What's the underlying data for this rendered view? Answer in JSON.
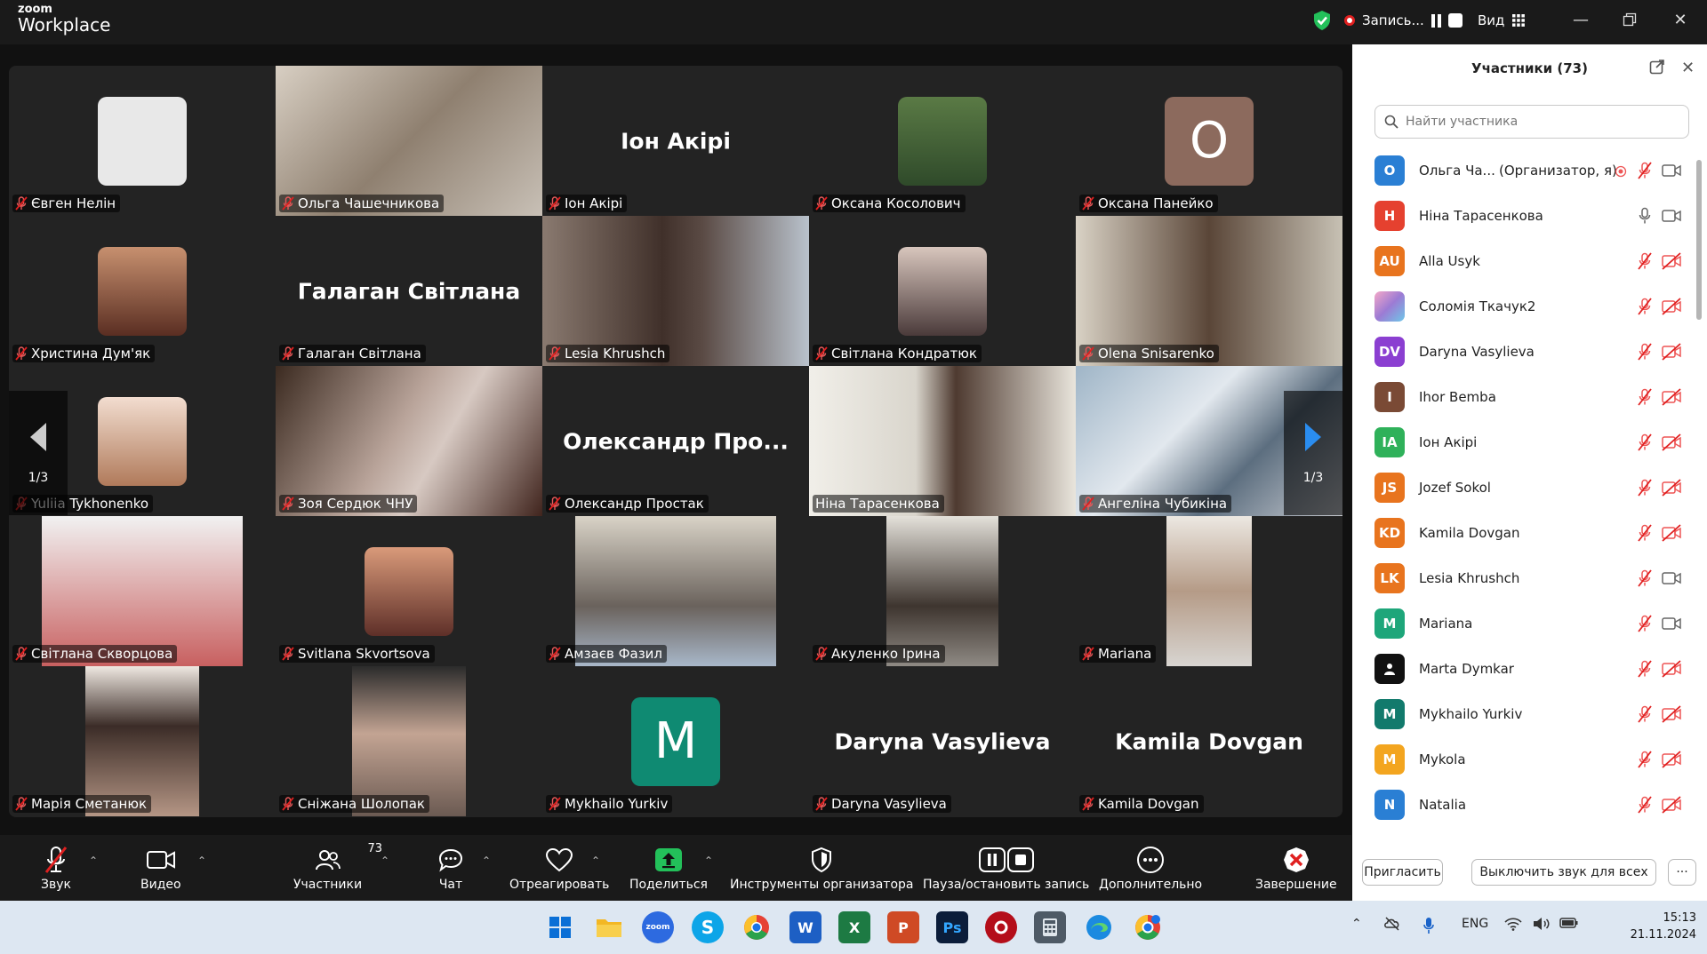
{
  "app": {
    "logo_top": "zoom",
    "logo_bottom": "Workplace"
  },
  "titlebar": {
    "recording_label": "Запись...",
    "view_label": "Вид"
  },
  "gallery": {
    "page_indicator_left": "1/3",
    "page_indicator_right": "1/3",
    "tiles": [
      {
        "name": "Євген Нелін",
        "kind": "photo"
      },
      {
        "name": "Ольга Чашечникова",
        "kind": "video"
      },
      {
        "name": "Іон Акірі",
        "kind": "text",
        "big": "Іон Акірі"
      },
      {
        "name": "Оксана Косолович",
        "kind": "photo"
      },
      {
        "name": "Оксана Панейко",
        "kind": "avatar",
        "letter": "O"
      },
      {
        "name": "Христина Дум'як",
        "kind": "photo"
      },
      {
        "name": "Галаган Світлана",
        "kind": "text",
        "big": "Галаган Світлана"
      },
      {
        "name": "Lesia Khrushch",
        "kind": "video"
      },
      {
        "name": "Світлана Кондратюк",
        "kind": "photo"
      },
      {
        "name": "Olena Snisarenko",
        "kind": "video"
      },
      {
        "name": "Yuliia Tykhonenko",
        "kind": "photo"
      },
      {
        "name": "Зоя Сердюк ЧНУ",
        "kind": "video"
      },
      {
        "name": "Олександр Простак",
        "kind": "text",
        "big": "Олександр  Про..."
      },
      {
        "name": "Ніна Тарасенкова",
        "kind": "video"
      },
      {
        "name": "Ангеліна Чубикіна",
        "kind": "video"
      },
      {
        "name": "Світлана Скворцова",
        "kind": "video"
      },
      {
        "name": "Svitlana Skvortsova",
        "kind": "photo"
      },
      {
        "name": "Амзаєв Фазил",
        "kind": "video"
      },
      {
        "name": "Акуленко Ірина",
        "kind": "video"
      },
      {
        "name": "Mariana",
        "kind": "video"
      },
      {
        "name": "Марія Сметанюк",
        "kind": "video"
      },
      {
        "name": "Сніжана Шолопак",
        "kind": "video"
      },
      {
        "name": "Mykhailo Yurkiv",
        "kind": "avatar",
        "letter": "M"
      },
      {
        "name": "Daryna Vasylieva",
        "kind": "text",
        "big": "Daryna Vasylieva"
      },
      {
        "name": "Kamila Dovgan",
        "kind": "text",
        "big": "Kamila Dovgan"
      }
    ]
  },
  "toolbar": {
    "audio": "Звук",
    "video": "Видео",
    "participants": "Участники",
    "participants_count": "73",
    "chat": "Чат",
    "react": "Отреагировать",
    "share": "Поделиться",
    "host_tools": "Инструменты организатора",
    "pause_record": "Пауза/остановить запись",
    "more": "Дополнительно",
    "end": "Завершение"
  },
  "panel": {
    "title": "Участники (73)",
    "search_placeholder": "Найти участника",
    "invite": "Пригласить",
    "mute_all": "Выключить звук для всех",
    "more": "···",
    "participants": [
      {
        "initials": "O",
        "name": "Ольга Ча...",
        "role": "(Организатор, я)",
        "color": "#2a7fd4",
        "mic": "off",
        "cam": "on"
      },
      {
        "initials": "H",
        "name": "Ніна Тарасенкова",
        "role": "",
        "color": "#e5412f",
        "mic": "on",
        "cam": "on"
      },
      {
        "initials": "AU",
        "name": "Alla Usyk",
        "role": "",
        "color": "#e8741e",
        "mic": "off",
        "cam": "off"
      },
      {
        "initials": "",
        "name": "Соломія Ткачук2",
        "role": "",
        "color": "#9c7bd4",
        "mic": "off",
        "cam": "off"
      },
      {
        "initials": "DV",
        "name": "Daryna Vasylieva",
        "role": "",
        "color": "#8b3fd1",
        "mic": "off",
        "cam": "off"
      },
      {
        "initials": "I",
        "name": "Ihor Bemba",
        "role": "",
        "color": "#7a4a35",
        "mic": "off",
        "cam": "off"
      },
      {
        "initials": "IA",
        "name": "Іон Акірі",
        "role": "",
        "color": "#2fb15a",
        "mic": "off",
        "cam": "off"
      },
      {
        "initials": "JS",
        "name": "Jozef Sokol",
        "role": "",
        "color": "#e8741e",
        "mic": "off",
        "cam": "off"
      },
      {
        "initials": "KD",
        "name": "Kamila Dovgan",
        "role": "",
        "color": "#e8741e",
        "mic": "off",
        "cam": "off"
      },
      {
        "initials": "LK",
        "name": "Lesia Khrushch",
        "role": "",
        "color": "#e8741e",
        "mic": "off",
        "cam": "on"
      },
      {
        "initials": "M",
        "name": "Mariana",
        "role": "",
        "color": "#1ea67a",
        "mic": "off",
        "cam": "on"
      },
      {
        "initials": "",
        "name": "Marta Dymkar",
        "role": "",
        "color": "#111111",
        "mic": "off",
        "cam": "off"
      },
      {
        "initials": "M",
        "name": "Mykhailo Yurkiv",
        "role": "",
        "color": "#127a6c",
        "mic": "off",
        "cam": "off"
      },
      {
        "initials": "M",
        "name": "Mykola",
        "role": "",
        "color": "#f3a51f",
        "mic": "off",
        "cam": "off"
      },
      {
        "initials": "N",
        "name": "Natalia",
        "role": "",
        "color": "#2a7fd4",
        "mic": "off",
        "cam": "off"
      }
    ]
  },
  "taskbar": {
    "lang": "ENG",
    "time": "15:13",
    "date": "21.11.2024"
  }
}
